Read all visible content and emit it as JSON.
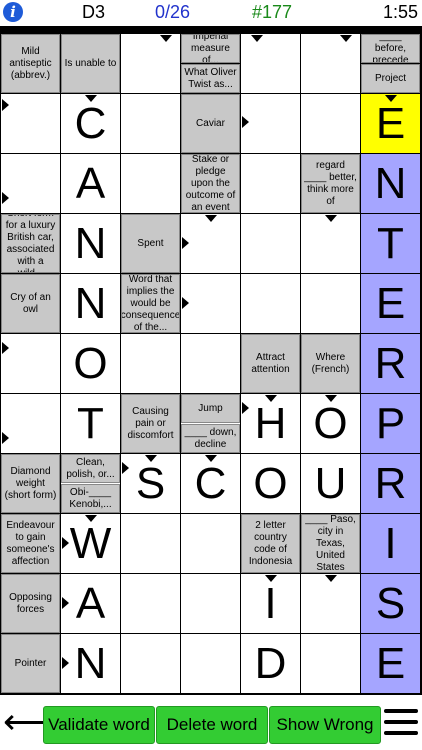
{
  "header": {
    "info_label": "i",
    "puzzle_id": "D3",
    "progress": "0/26",
    "puzzle_number": "#177",
    "timer": "1:55"
  },
  "colors": {
    "clue_bg": "#c8c8c8",
    "highlight": "#a5a5ff",
    "current_cell": "#ffff00",
    "progress_text": "#2233cc",
    "number_text": "#1a8a1a",
    "button": "#33cc33"
  },
  "clues": [
    {
      "id": "clue-mild-antiseptic",
      "text": "Mild antiseptic (abbrev.)"
    },
    {
      "id": "clue-unable",
      "text": "Is unable to"
    },
    {
      "id": "clue-imperial",
      "text": "Imperial measure of..."
    },
    {
      "id": "clue-oliver",
      "text": "What Oliver Twist as..."
    },
    {
      "id": "clue-before",
      "text": "____ before, precede"
    },
    {
      "id": "clue-project",
      "text": "Project"
    },
    {
      "id": "clue-caviar",
      "text": "Caviar"
    },
    {
      "id": "clue-stake",
      "text": "Stake or pledge upon the outcome of an event"
    },
    {
      "id": "clue-regard",
      "text": "regard ____ better, think more of"
    },
    {
      "id": "clue-shortform",
      "text": "Short form for a luxury British car, associated with a wild..."
    },
    {
      "id": "clue-spent",
      "text": "Spent"
    },
    {
      "id": "clue-owl",
      "text": "Cry of an owl"
    },
    {
      "id": "clue-implies",
      "text": "Word that implies the would be consequence of the..."
    },
    {
      "id": "clue-attract",
      "text": "Attract attention"
    },
    {
      "id": "clue-where",
      "text": "Where (French)"
    },
    {
      "id": "clue-causing",
      "text": "Causing pain or discomfort"
    },
    {
      "id": "clue-jump",
      "text": "Jump"
    },
    {
      "id": "clue-down",
      "text": "____ down, decline"
    },
    {
      "id": "clue-diamond",
      "text": "Diamond weight (short form)"
    },
    {
      "id": "clue-clean",
      "text": "Clean, polish, or..."
    },
    {
      "id": "clue-obi",
      "text": "Obi-____ Kenobi,..."
    },
    {
      "id": "clue-endeavour",
      "text": "Endeavour to gain someone's affection"
    },
    {
      "id": "clue-indonesia",
      "text": "2 letter country code of Indonesia"
    },
    {
      "id": "clue-paso",
      "text": "____ Paso, city in Texas, United States"
    },
    {
      "id": "clue-opposing",
      "text": "Opposing forces"
    },
    {
      "id": "clue-pointer",
      "text": "Pointer"
    }
  ],
  "letters": {
    "c1r1": "C",
    "c1r2": "A",
    "c1r3": "N",
    "c1r4": "N",
    "c1r5": "O",
    "c1r6": "T",
    "c1r8": "W",
    "c1r9": "A",
    "c1r10": "N",
    "c6r1": "E",
    "c6r2": "N",
    "c6r3": "T",
    "c6r4": "E",
    "c6r5": "R",
    "c6r6": "P",
    "c6r7": "R",
    "c6r8": "I",
    "c6r9": "S",
    "c6r10": "E",
    "c2r7": "S",
    "c3r7": "C",
    "c4r7": "O",
    "c5r7": "U",
    "c4r6": "H",
    "c5r6": "O",
    "c4r9": "I",
    "c4r10": "D"
  },
  "buttons": {
    "back_label": "⟵",
    "validate": "Validate word",
    "delete": "Delete word",
    "show_wrong": "Show Wrong"
  }
}
